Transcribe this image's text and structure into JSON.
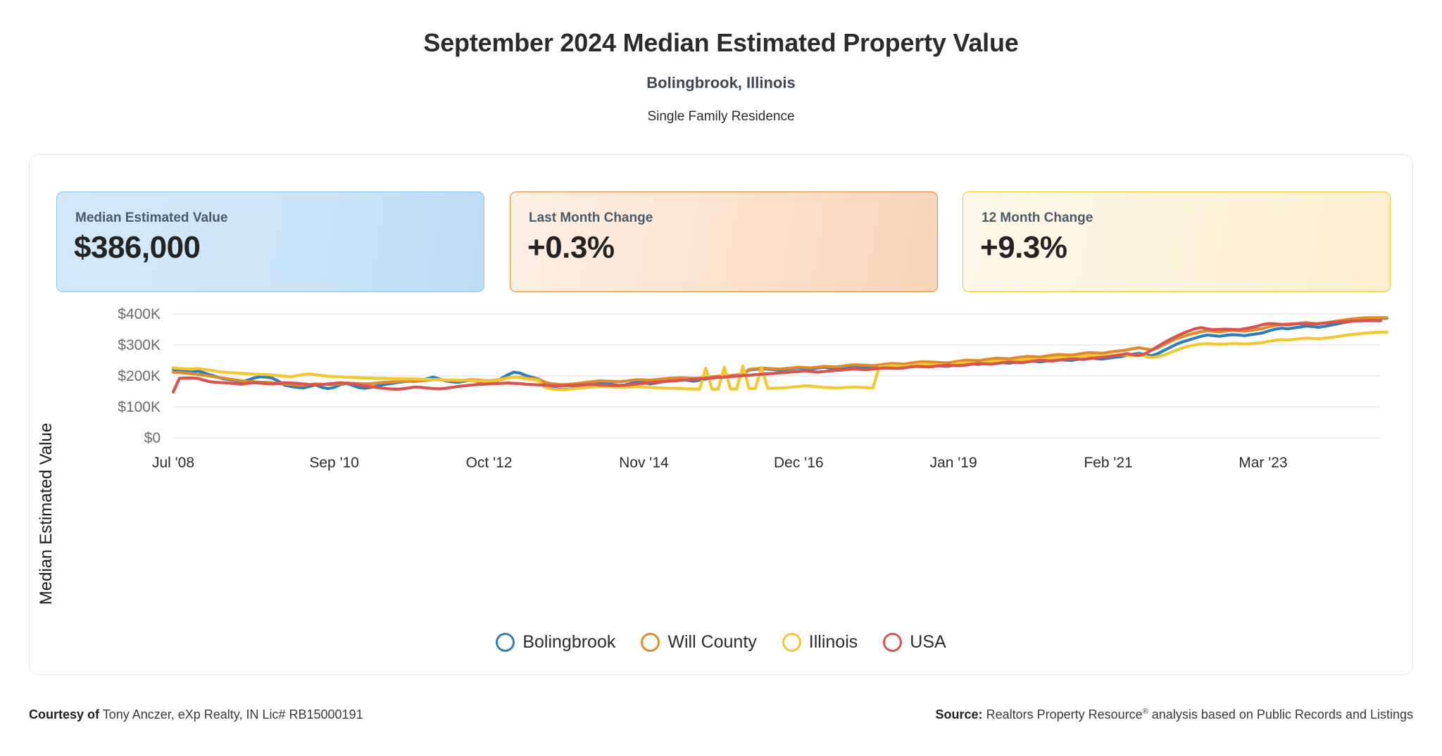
{
  "header": {
    "title": "September 2024 Median Estimated Property Value",
    "subtitle": "Bolingbrook, Illinois",
    "property_type": "Single Family Residence"
  },
  "kpis": [
    {
      "label": "Median Estimated Value",
      "value": "$386,000",
      "accent": "#8ec4e8"
    },
    {
      "label": "Last Month Change",
      "value": "+0.3%",
      "accent": "#e08a3c"
    },
    {
      "label": "12 Month Change",
      "value": "+9.3%",
      "accent": "#edc92e"
    }
  ],
  "legend": [
    {
      "label": "Bolingbrook",
      "color": "#2e7ebb"
    },
    {
      "label": "Will County",
      "color": "#e08a2e"
    },
    {
      "label": "Illinois",
      "color": "#f2c832"
    },
    {
      "label": "USA",
      "color": "#d9534f"
    }
  ],
  "footer": {
    "courtesy_label": "Courtesy of",
    "courtesy_value": "Tony Anczer, eXp Realty, IN Lic# RB15000191",
    "source_label": "Source:",
    "source_value_pre": "Realtors Property Resource",
    "source_value_sup": "®",
    "source_value_post": " analysis based on Public Records and Listings"
  },
  "chart_data": {
    "type": "line",
    "title": "September 2024 Median Estimated Property Value",
    "xlabel": "",
    "ylabel": "Median Estimated Value",
    "ylim": [
      0,
      400000
    ],
    "yticks": [
      0,
      100000,
      200000,
      300000,
      400000
    ],
    "ytick_labels": [
      "$0",
      "$100K",
      "$200K",
      "$300K",
      "$400K"
    ],
    "xtick_labels": [
      "Jul '08",
      "Sep '10",
      "Oct '12",
      "Nov '14",
      "Dec '16",
      "Jan '19",
      "Feb '21",
      "Mar '23"
    ],
    "xtick_positions": [
      0,
      26,
      51,
      76,
      101,
      126,
      151,
      176
    ],
    "x_count": 196,
    "grid": true,
    "legend_position": "bottom",
    "series": [
      {
        "name": "Bolingbrook",
        "color": "#2e7ebb",
        "values": [
          221000,
          218000,
          215000,
          212000,
          216000,
          210000,
          203000,
          197000,
          191000,
          188000,
          185000,
          181000,
          186000,
          193000,
          197000,
          196000,
          193000,
          183000,
          170000,
          166000,
          163000,
          161000,
          166000,
          171000,
          163000,
          159000,
          163000,
          172000,
          176000,
          169000,
          162000,
          160000,
          163000,
          168000,
          172000,
          175000,
          178000,
          181000,
          183000,
          182000,
          186000,
          191000,
          196000,
          190000,
          184000,
          181000,
          179000,
          183000,
          186000,
          183000,
          178000,
          175000,
          180000,
          192000,
          203000,
          212000,
          209000,
          201000,
          195000,
          190000,
          174000,
          163000,
          158000,
          156000,
          158000,
          162000,
          166000,
          170000,
          174000,
          178000,
          176000,
          172000,
          169000,
          171000,
          176000,
          180000,
          178000,
          174000,
          177000,
          181000,
          185000,
          187000,
          189000,
          186000,
          183000,
          186000,
          190000,
          193000,
          196000,
          198000,
          200000,
          203000,
          205000,
          219000,
          221000,
          223000,
          222000,
          220000,
          219000,
          221000,
          223000,
          225000,
          224000,
          222000,
          225000,
          228000,
          226000,
          224000,
          227000,
          230000,
          232000,
          230000,
          228000,
          226000,
          229000,
          231000,
          234000,
          232000,
          230000,
          233000,
          236000,
          238000,
          236000,
          234000,
          232000,
          231000,
          234000,
          238000,
          241000,
          239000,
          237000,
          240000,
          243000,
          245000,
          243000,
          241000,
          244000,
          247000,
          249000,
          247000,
          245000,
          248000,
          251000,
          253000,
          251000,
          250000,
          253000,
          256000,
          258000,
          256000,
          254000,
          257000,
          260000,
          262000,
          266000,
          270000,
          273000,
          268000,
          265000,
          272000,
          282000,
          292000,
          302000,
          310000,
          316000,
          322000,
          328000,
          332000,
          330000,
          328000,
          331000,
          333000,
          332000,
          330000,
          333000,
          336000,
          339000,
          346000,
          351000,
          354000,
          352000,
          355000,
          358000,
          361000,
          359000,
          357000,
          360000,
          364000,
          368000,
          372000,
          376000,
          379000,
          382000,
          385000,
          386000,
          386000,
          386000
        ]
      },
      {
        "name": "Will County",
        "color": "#e08a2e",
        "values": [
          212000,
          211000,
          209000,
          207000,
          205000,
          202000,
          199000,
          196000,
          193000,
          190000,
          187000,
          184000,
          182000,
          181000,
          180000,
          179000,
          178000,
          176000,
          174000,
          172000,
          171000,
          170000,
          172000,
          174000,
          173000,
          172000,
          173000,
          175000,
          177000,
          176000,
          175000,
          174000,
          175000,
          177000,
          179000,
          180000,
          181000,
          182000,
          183000,
          183000,
          184000,
          186000,
          188000,
          187000,
          186000,
          185000,
          184000,
          186000,
          188000,
          187000,
          185000,
          184000,
          186000,
          190000,
          194000,
          196000,
          195000,
          193000,
          191000,
          189000,
          180000,
          175000,
          173000,
          172000,
          173000,
          175000,
          177000,
          180000,
          182000,
          184000,
          183000,
          182000,
          181000,
          183000,
          186000,
          188000,
          187000,
          186000,
          188000,
          190000,
          192000,
          193000,
          194000,
          193000,
          192000,
          193000,
          195000,
          197000,
          199000,
          200000,
          201000,
          203000,
          205000,
          221000,
          223000,
          225000,
          224000,
          223000,
          222000,
          224000,
          226000,
          228000,
          227000,
          226000,
          228000,
          231000,
          230000,
          229000,
          231000,
          234000,
          236000,
          235000,
          234000,
          233000,
          235000,
          238000,
          240000,
          239000,
          238000,
          241000,
          244000,
          246000,
          245000,
          244000,
          243000,
          242000,
          245000,
          248000,
          251000,
          250000,
          249000,
          252000,
          255000,
          257000,
          256000,
          255000,
          258000,
          261000,
          263000,
          262000,
          261000,
          264000,
          267000,
          269000,
          268000,
          267000,
          270000,
          273000,
          275000,
          274000,
          273000,
          276000,
          279000,
          281000,
          284000,
          288000,
          291000,
          287000,
          284000,
          291000,
          301000,
          311000,
          320000,
          327000,
          333000,
          338000,
          343000,
          346000,
          344000,
          342000,
          345000,
          347000,
          346000,
          344000,
          347000,
          350000,
          353000,
          359000,
          363000,
          366000,
          364000,
          367000,
          370000,
          372000,
          370000,
          368000,
          371000,
          374000,
          377000,
          380000,
          383000,
          385000,
          387000,
          388000,
          388000,
          388000,
          388000
        ]
      },
      {
        "name": "Illinois",
        "color": "#f2c832",
        "values": [
          226000,
          224000,
          223000,
          222000,
          224000,
          221000,
          218000,
          215000,
          212000,
          211000,
          210000,
          208000,
          207000,
          206000,
          205000,
          204000,
          203000,
          201000,
          199000,
          197000,
          201000,
          204000,
          206000,
          204000,
          201000,
          199000,
          198000,
          197000,
          196000,
          195000,
          194000,
          193000,
          193000,
          192000,
          192000,
          191000,
          191000,
          190000,
          190000,
          190000,
          189000,
          189000,
          188000,
          188000,
          187000,
          187000,
          186000,
          186000,
          185000,
          184000,
          183000,
          182000,
          184000,
          188000,
          193000,
          196000,
          194000,
          191000,
          188000,
          185000,
          163000,
          158000,
          156000,
          155000,
          157000,
          159000,
          161000,
          163000,
          164000,
          166000,
          165000,
          164000,
          163000,
          163000,
          164000,
          165000,
          164000,
          163000,
          162000,
          161000,
          160000,
          160000,
          159000,
          158000,
          158000,
          157000,
          225000,
          157000,
          157000,
          228000,
          158000,
          158000,
          232000,
          159000,
          159000,
          228000,
          160000,
          160000,
          161000,
          162000,
          164000,
          166000,
          168000,
          167000,
          165000,
          163000,
          162000,
          161000,
          162000,
          163000,
          164000,
          163000,
          162000,
          161000,
          228000,
          231000,
          233000,
          232000,
          231000,
          233000,
          236000,
          238000,
          237000,
          236000,
          235000,
          234000,
          237000,
          240000,
          242000,
          241000,
          240000,
          243000,
          246000,
          248000,
          247000,
          246000,
          249000,
          252000,
          254000,
          253000,
          252000,
          255000,
          258000,
          260000,
          259000,
          258000,
          261000,
          263000,
          265000,
          264000,
          263000,
          265000,
          267000,
          268000,
          267000,
          266000,
          268000,
          263000,
          259000,
          262000,
          268000,
          275000,
          283000,
          290000,
          296000,
          300000,
          303000,
          304000,
          303000,
          302000,
          303000,
          304000,
          304000,
          303000,
          304000,
          306000,
          308000,
          312000,
          315000,
          317000,
          316000,
          318000,
          320000,
          322000,
          321000,
          320000,
          322000,
          324000,
          327000,
          330000,
          333000,
          335000,
          337000,
          339000,
          340000,
          341000,
          341000
        ]
      },
      {
        "name": "USA",
        "color": "#d9534f",
        "values": [
          148000,
          192000,
          193000,
          193000,
          192000,
          186000,
          181000,
          179000,
          178000,
          177000,
          175000,
          173000,
          176000,
          178000,
          177000,
          175000,
          174000,
          176000,
          178000,
          177000,
          176000,
          174000,
          172000,
          171000,
          172000,
          174000,
          176000,
          178000,
          176000,
          174000,
          171000,
          168000,
          165000,
          162000,
          160000,
          158000,
          157000,
          158000,
          161000,
          164000,
          163000,
          161000,
          159000,
          158000,
          160000,
          163000,
          166000,
          168000,
          170000,
          172000,
          173000,
          174000,
          175000,
          176000,
          177000,
          176000,
          175000,
          173000,
          172000,
          171000,
          170000,
          169000,
          168000,
          168000,
          169000,
          170000,
          171000,
          172000,
          172000,
          171000,
          170000,
          169000,
          169000,
          170000,
          172000,
          174000,
          176000,
          178000,
          180000,
          181000,
          183000,
          184000,
          186000,
          187000,
          189000,
          190000,
          192000,
          193000,
          195000,
          196000,
          198000,
          199000,
          201000,
          202000,
          204000,
          205000,
          207000,
          208000,
          210000,
          211000,
          213000,
          214000,
          216000,
          214000,
          212000,
          214000,
          216000,
          218000,
          219000,
          221000,
          222000,
          221000,
          220000,
          222000,
          224000,
          226000,
          225000,
          224000,
          226000,
          229000,
          231000,
          230000,
          229000,
          231000,
          233000,
          235000,
          234000,
          233000,
          235000,
          238000,
          240000,
          239000,
          238000,
          240000,
          243000,
          245000,
          244000,
          243000,
          245000,
          248000,
          250000,
          249000,
          248000,
          251000,
          253000,
          255000,
          254000,
          253000,
          256000,
          258000,
          260000,
          262000,
          265000,
          268000,
          272000,
          268000,
          266000,
          272000,
          283000,
          295000,
          307000,
          318000,
          328000,
          337000,
          345000,
          352000,
          356000,
          352000,
          349000,
          350000,
          351000,
          350000,
          349000,
          352000,
          356000,
          360000,
          366000,
          369000,
          368000,
          366000,
          367000,
          368000,
          369000,
          368000,
          367000,
          369000,
          371000,
          372000,
          374000,
          375000,
          376000,
          377000,
          378000,
          378000,
          378000,
          378000
        ]
      }
    ]
  }
}
